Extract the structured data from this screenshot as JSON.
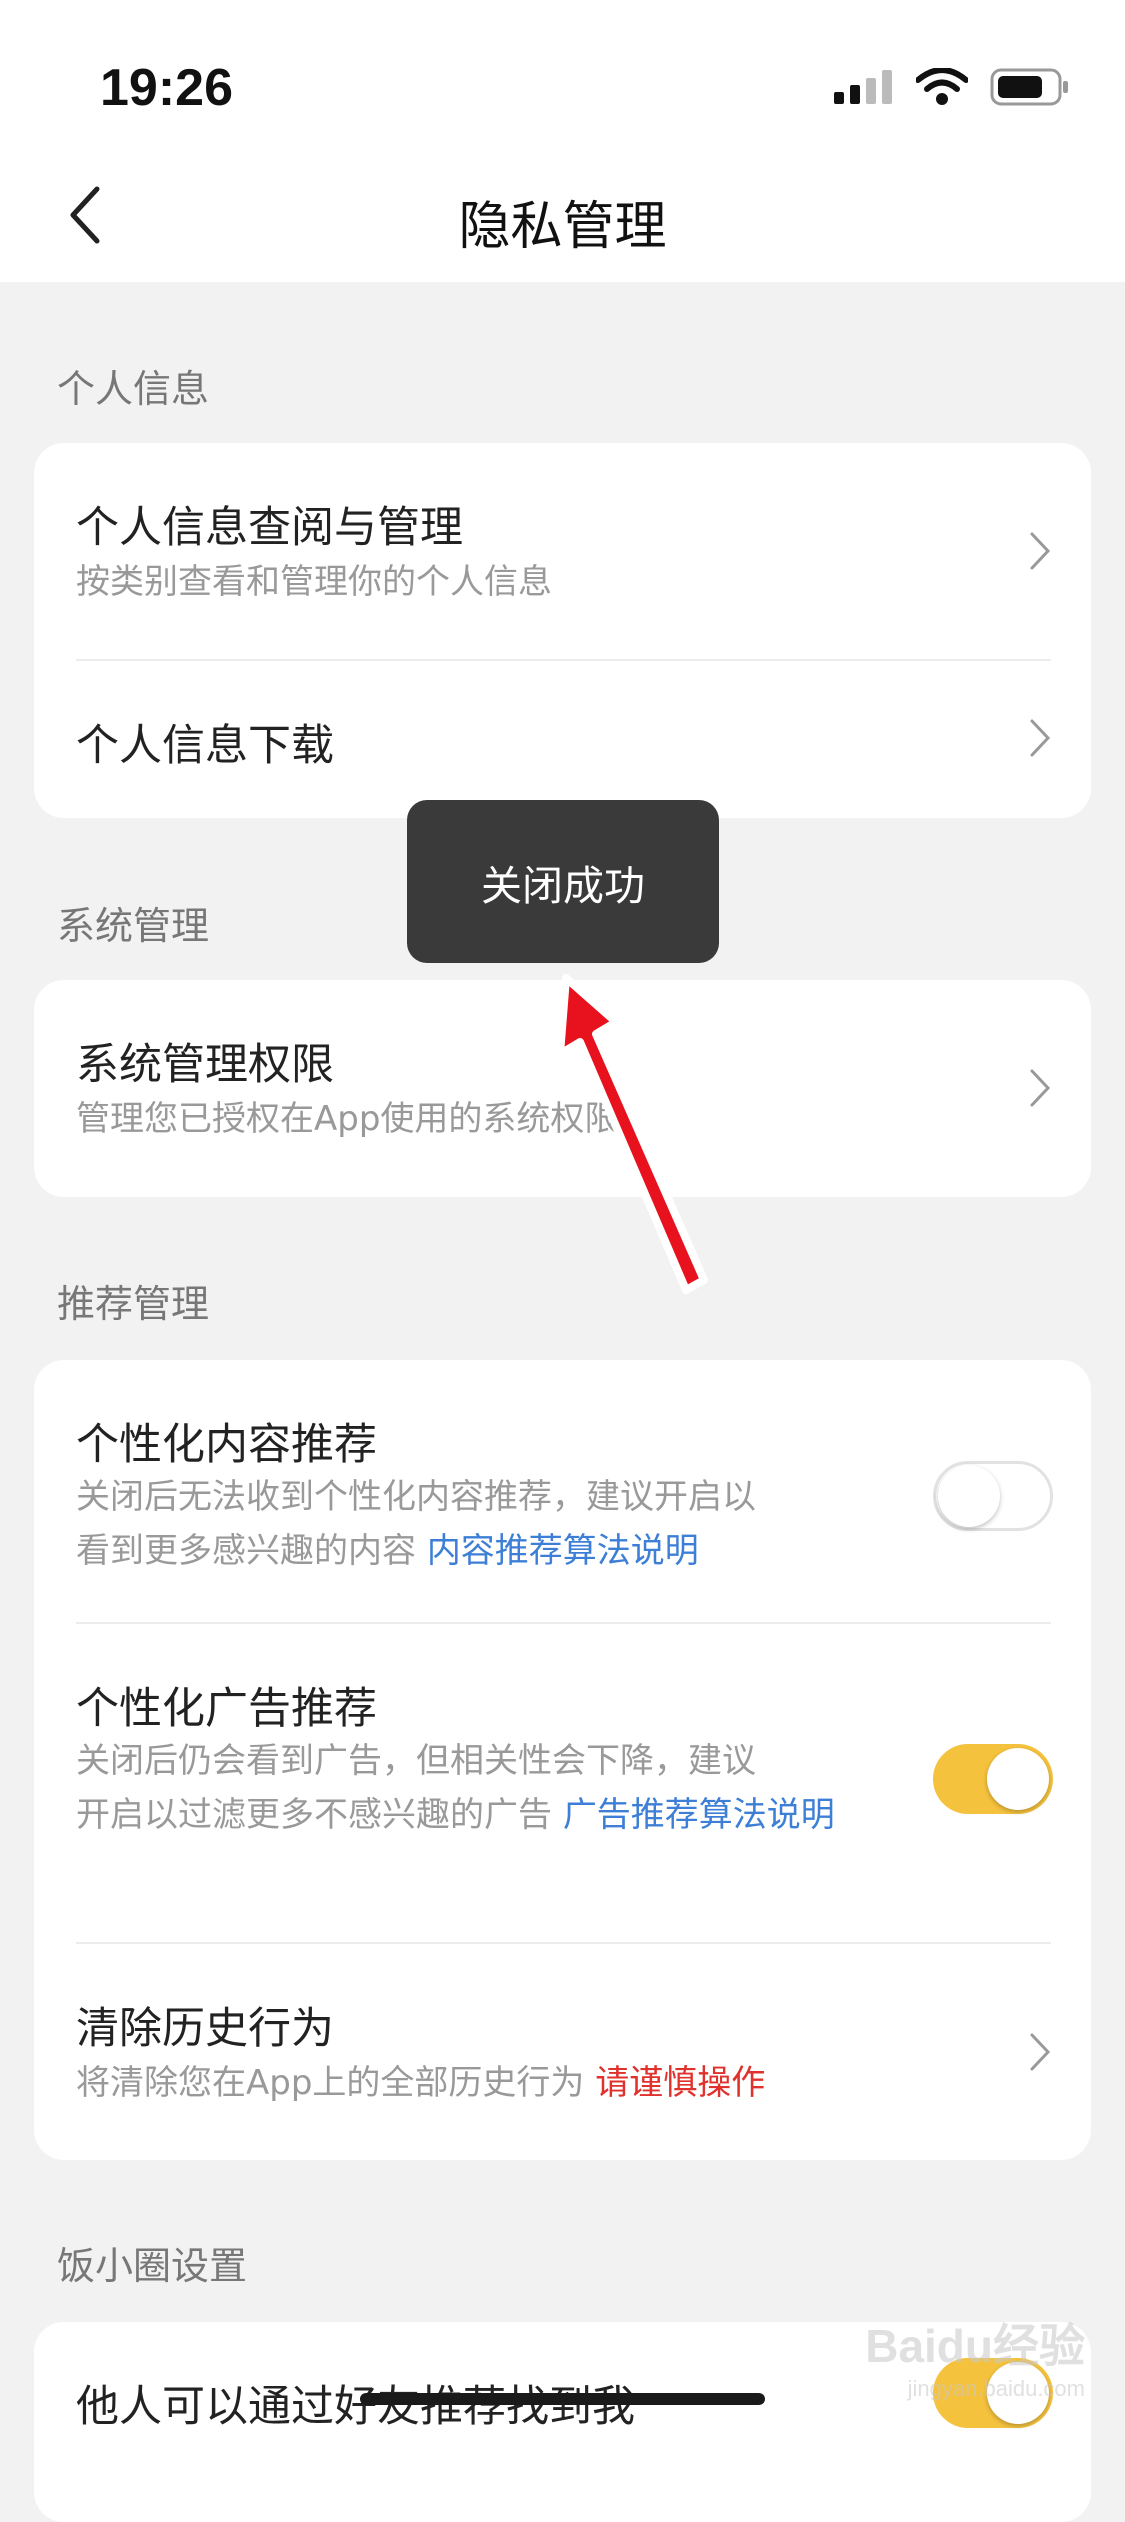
{
  "status_bar": {
    "time": "19:26",
    "icons": [
      "signal-icon",
      "wifi-icon",
      "battery-icon"
    ]
  },
  "nav": {
    "title": "隐私管理",
    "back_icon": "chevron-left-icon"
  },
  "sections": {
    "personal": {
      "header": "个人信息",
      "items": [
        {
          "title": "个人信息查阅与管理",
          "subtitle": "按类别查看和管理你的个人信息"
        },
        {
          "title": "个人信息下载"
        }
      ]
    },
    "system": {
      "header": "系统管理",
      "items": [
        {
          "title": "系统管理权限",
          "subtitle": "管理您已授权在App使用的系统权限"
        }
      ]
    },
    "recommend": {
      "header": "推荐管理",
      "items": [
        {
          "title": "个性化内容推荐",
          "sub_line1": "关闭后无法收到个性化内容推荐，建议开启以",
          "sub_line2": "看到更多感兴趣的内容 ",
          "link": "内容推荐算法说明",
          "toggle_on": false
        },
        {
          "title": "个性化广告推荐",
          "sub_line1": "关闭后仍会看到广告，但相关性会下降，建议",
          "sub_line2": "开启以过滤更多不感兴趣的广告 ",
          "link": "广告推荐算法说明",
          "toggle_on": true
        },
        {
          "title": "清除历史行为",
          "subtitle": "将清除您在App上的全部历史行为 ",
          "warning": "请谨慎操作"
        }
      ]
    },
    "circle": {
      "header": "饭小圈设置",
      "items": [
        {
          "title": "他人可以通过好友推荐找到我",
          "toggle_on": true
        }
      ]
    }
  },
  "toast": {
    "text": "关闭成功"
  },
  "watermark": {
    "main": "Baidu经验",
    "sub": "jingyan.baidu.com"
  },
  "colors": {
    "toggle_on": "#f5c23e",
    "link": "#3d7fd6",
    "warning": "#e0312c",
    "annotation_arrow": "#e8121e"
  }
}
